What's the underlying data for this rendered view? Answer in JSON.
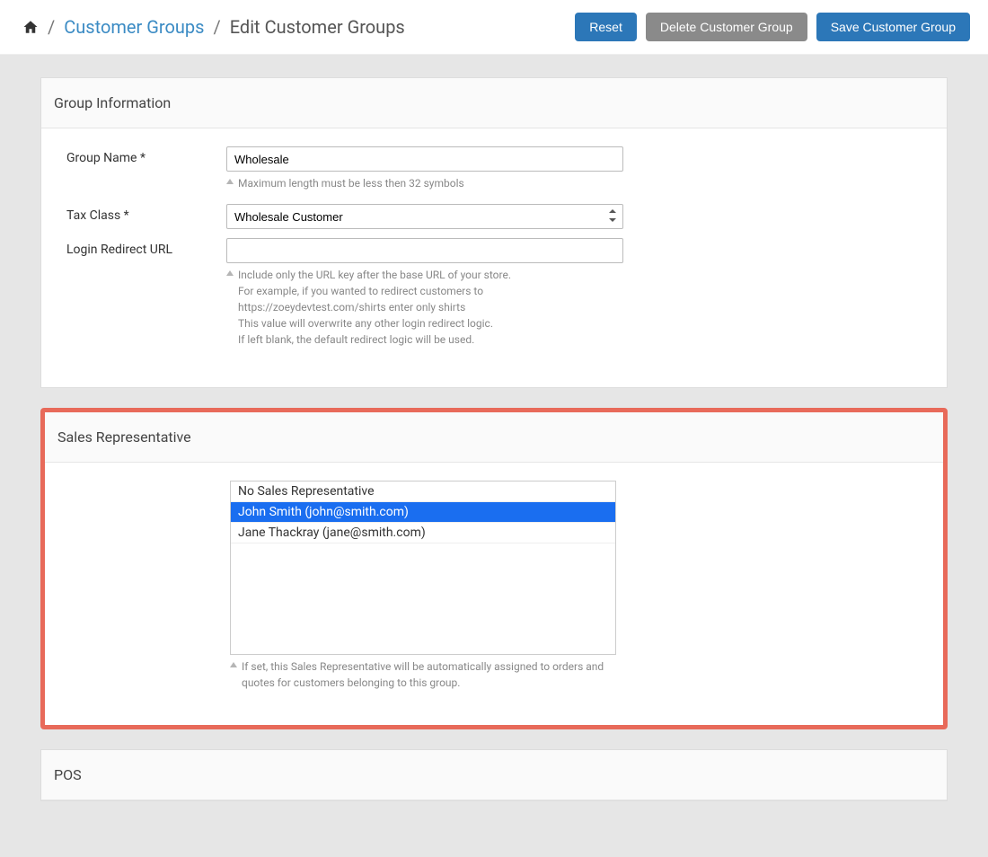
{
  "breadcrumb": {
    "link_label": "Customer Groups",
    "current": "Edit Customer Groups"
  },
  "buttons": {
    "reset": "Reset",
    "delete": "Delete Customer Group",
    "save": "Save Customer Group"
  },
  "panel_group_info": {
    "title": "Group Information",
    "group_name_label": "Group Name *",
    "group_name_value": "Wholesale",
    "group_name_help": "Maximum length must be less then 32 symbols",
    "tax_class_label": "Tax Class *",
    "tax_class_value": "Wholesale Customer",
    "login_url_label": "Login Redirect URL",
    "login_url_value": "",
    "login_url_help_l1": "Include only the URL key after the base URL of your store.",
    "login_url_help_l2": "For example, if you wanted to redirect customers to https://zoeydevtest.com/shirts enter only shirts",
    "login_url_help_l3": "This value will overwrite any other login redirect logic.",
    "login_url_help_l4": "If left blank, the default redirect logic will be used."
  },
  "panel_sales_rep": {
    "title": "Sales Representative",
    "options": [
      "No Sales Representative",
      "John Smith (john@smith.com)",
      "Jane Thackray (jane@smith.com)"
    ],
    "selected_index": 1,
    "help": "If set, this Sales Representative will be automatically assigned to orders and quotes for customers belonging to this group."
  },
  "panel_pos": {
    "title": "POS"
  }
}
